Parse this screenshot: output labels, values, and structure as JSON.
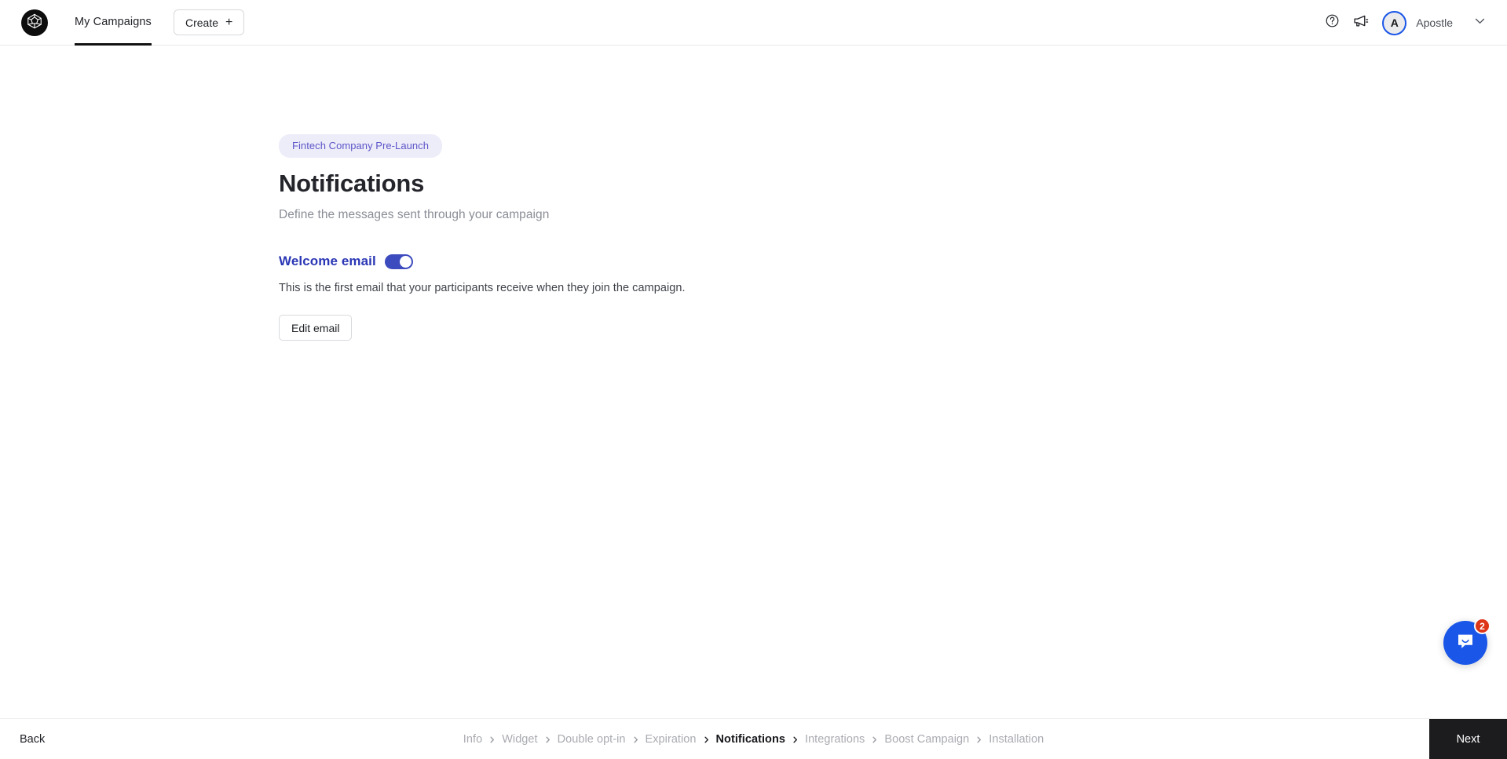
{
  "header": {
    "logo_icon": "gem-polyhedron-logo",
    "nav_tab_label": "My Campaigns",
    "create_label": "Create",
    "create_icon": "plus-icon",
    "help_icon": "question-circle-icon",
    "announcements_icon": "megaphone-icon",
    "avatar_initial": "A",
    "username": "Apostle",
    "chevron_icon": "chevron-down-icon"
  },
  "main": {
    "campaign_badge": "Fintech Company Pre-Launch",
    "title": "Notifications",
    "subtitle": "Define the messages sent through your campaign",
    "section": {
      "title": "Welcome email",
      "toggle_state": "on",
      "description": "This is the first email that your participants receive when they join the campaign.",
      "edit_label": "Edit email"
    }
  },
  "chat": {
    "icon": "chat-bubble-icon",
    "unread_count": "2"
  },
  "footer": {
    "back_label": "Back",
    "next_label": "Next",
    "separator": "›",
    "breadcrumb": [
      {
        "label": "Info",
        "active": false
      },
      {
        "label": "Widget",
        "active": false
      },
      {
        "label": "Double opt-in",
        "active": false
      },
      {
        "label": "Expiration",
        "active": false
      },
      {
        "label": "Notifications",
        "active": true
      },
      {
        "label": "Integrations",
        "active": false
      },
      {
        "label": "Boost Campaign",
        "active": false
      },
      {
        "label": "Installation",
        "active": false
      }
    ]
  },
  "colors": {
    "accent_blue": "#1a56e8",
    "toggle_blue": "#3c4bbd",
    "section_title": "#2b37b5",
    "badge_bg": "#ededf9",
    "badge_text": "#5d55c9",
    "next_bg": "#1c1c1e",
    "chat_badge": "#de3618"
  }
}
